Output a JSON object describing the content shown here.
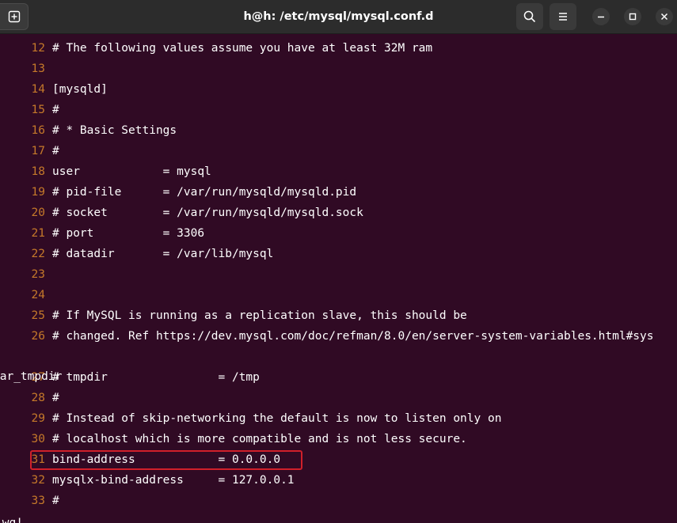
{
  "window": {
    "title": "h@h: /etc/mysql/mysql.conf.d"
  },
  "titlebar": {
    "icons": {
      "new_tab": "new-tab-icon",
      "search": "search-icon",
      "menu": "hamburger-menu-icon",
      "minimize": "minimize-icon",
      "maximize": "maximize-icon",
      "close": "close-icon"
    }
  },
  "editor": {
    "lines": [
      {
        "num": "12",
        "text": "# The following values assume you have at least 32M ram"
      },
      {
        "num": "13",
        "text": ""
      },
      {
        "num": "14",
        "text": "[mysqld]"
      },
      {
        "num": "15",
        "text": "#"
      },
      {
        "num": "16",
        "text": "# * Basic Settings"
      },
      {
        "num": "17",
        "text": "#"
      },
      {
        "num": "18",
        "text": "user            = mysql"
      },
      {
        "num": "19",
        "text": "# pid-file      = /var/run/mysqld/mysqld.pid"
      },
      {
        "num": "20",
        "text": "# socket        = /var/run/mysqld/mysqld.sock"
      },
      {
        "num": "21",
        "text": "# port          = 3306"
      },
      {
        "num": "22",
        "text": "# datadir       = /var/lib/mysql"
      },
      {
        "num": "23",
        "text": ""
      },
      {
        "num": "24",
        "text": ""
      },
      {
        "num": "25",
        "text": "# If MySQL is running as a replication slave, this should be"
      },
      {
        "num": "26",
        "text": "# changed. Ref https://dev.mysql.com/doc/refman/8.0/en/server-system-variables.html#sys"
      },
      {
        "num": "27",
        "text": "# tmpdir                = /tmp"
      },
      {
        "num": "28",
        "text": "#"
      },
      {
        "num": "29",
        "text": "# Instead of skip-networking the default is now to listen only on"
      },
      {
        "num": "30",
        "text": "# localhost which is more compatible and is not less secure."
      },
      {
        "num": "31",
        "text": "bind-address            = 0.0.0.0"
      },
      {
        "num": "32",
        "text": "mysqlx-bind-address     = 127.0.0.1"
      },
      {
        "num": "33",
        "text": "#"
      }
    ],
    "wrapped_continuation": "var_tmpdir",
    "command_line": ":wq!"
  },
  "colors": {
    "background": "#300a24",
    "line_number": "#c5792a",
    "highlight_box": "#d0202a",
    "titlebar": "#2c2c2c"
  }
}
